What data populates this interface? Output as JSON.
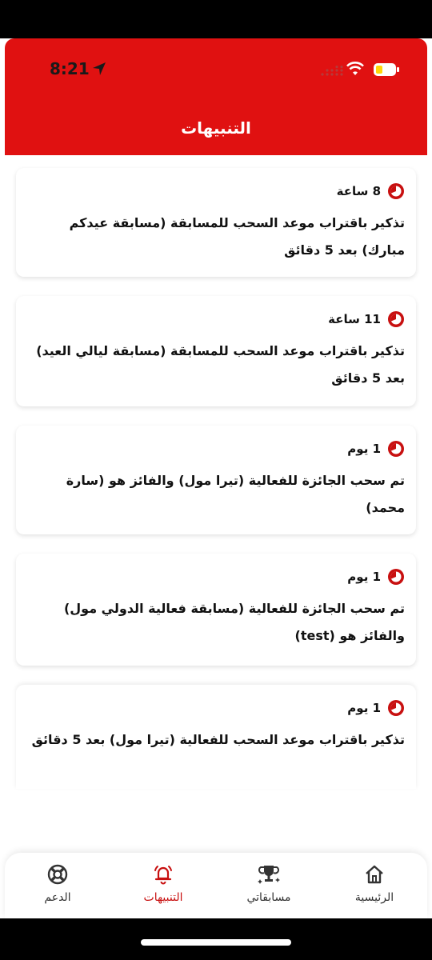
{
  "status": {
    "time": "8:21"
  },
  "header": {
    "title": "التنبيهات"
  },
  "notifications": [
    {
      "ago": "8 ساعة",
      "message": "تذكير باقتراب موعد السحب للمسابقة (مسابقة عيدكم مبارك) بعد 5 دقائق"
    },
    {
      "ago": "11 ساعة",
      "message": "تذكير باقتراب موعد السحب للمسابقة (مسابقة ليالي العيد) بعد 5 دقائق"
    },
    {
      "ago": "1 يوم",
      "message": "تم سحب الجائزة للفعالية (تيرا مول) والفائز هو (سارة محمد)"
    },
    {
      "ago": "1 يوم",
      "message": "تم سحب الجائزة للفعالية (مسابقة فعالية الدولي مول) والفائز هو (test)"
    },
    {
      "ago": "1 يوم",
      "message": "تذكير باقتراب موعد السحب للفعالية (تيرا مول) بعد 5 دقائق"
    }
  ],
  "nav": {
    "support": "الدعم",
    "notifications": "التنبيهات",
    "competitions": "مسابقاتي",
    "home": "الرئيسية"
  },
  "colors": {
    "accent": "#e01111",
    "active": "#c81010",
    "battery": "#ffd60a"
  }
}
